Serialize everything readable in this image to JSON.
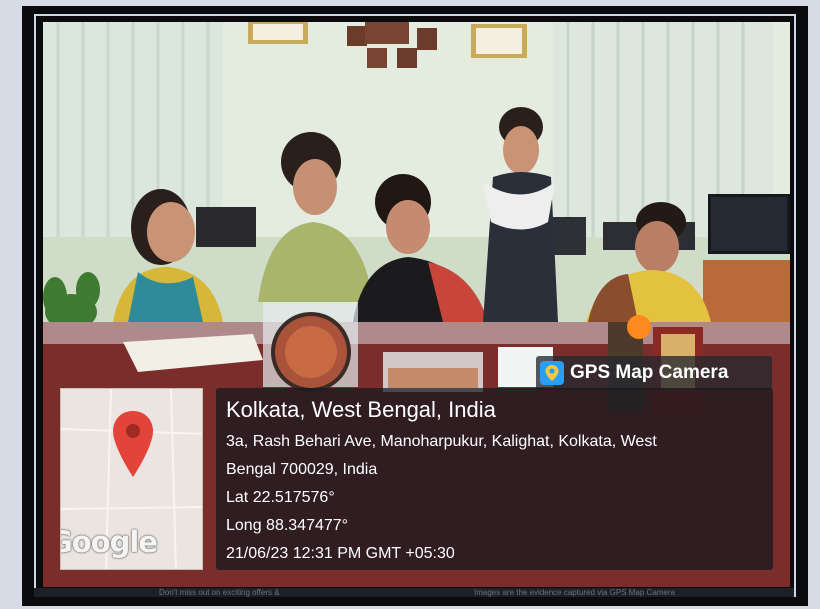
{
  "overlay": {
    "app_name": "GPS Map Camera",
    "map_logo": "Google",
    "location_title": "Kolkata, West Bengal, India",
    "address_line1": "3a, Rash Behari Ave, Manoharpukur, Kalighat, Kolkata, West",
    "address_line2": "Bengal 700029, India",
    "latitude": "Lat 22.517576°",
    "longitude": "Long 88.347477°",
    "datetime": "21/06/23 12:31 PM GMT +05:30"
  },
  "ticker": {
    "left_text": "Don't miss out on exciting offers &",
    "right_text": "Images are the evidence captured via GPS Map Camera"
  },
  "icons": {
    "badge_icon": "map-pin-app-icon",
    "map_pin": "location-pin-icon"
  },
  "colors": {
    "pin": "#e2443a",
    "badge_icon_bg": "#2a9df4",
    "overlay_bg": "#1a1e26"
  }
}
